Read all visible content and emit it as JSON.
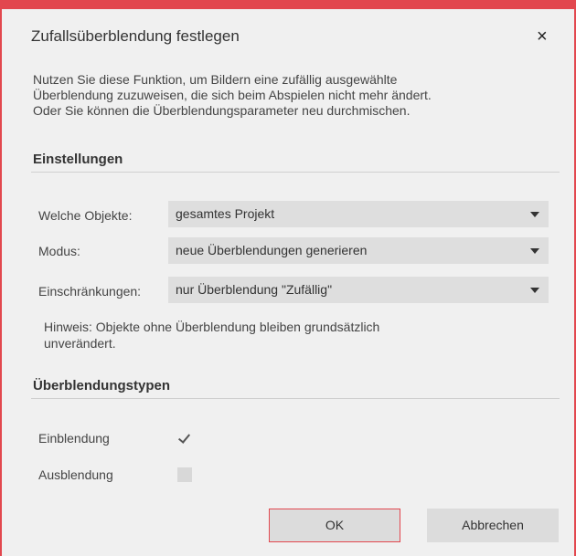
{
  "dialog": {
    "title": "Zufallsüberblendung festlegen",
    "close_glyph": "×",
    "accent_color": "#e2474e"
  },
  "description": {
    "line1": "Nutzen Sie diese Funktion, um Bildern eine zufällig ausgewählte",
    "line2": "Überblendung zuzuweisen, die sich beim Abspielen nicht mehr ändert.",
    "line3": "Oder Sie können die Überblendungsparameter neu durchmischen."
  },
  "settings": {
    "heading": "Einstellungen",
    "objects": {
      "label": "Welche Objekte:",
      "value": "gesamtes Projekt"
    },
    "mode": {
      "label": "Modus:",
      "value": "neue Überblendungen generieren"
    },
    "restrictions": {
      "label": "Einschränkungen:",
      "value": "nur Überblendung \"Zufällig\""
    },
    "hint_line1": "Hinweis: Objekte ohne Überblendung bleiben grundsätzlich",
    "hint_line2": "unverändert."
  },
  "types": {
    "heading": "Überblendungstypen",
    "fade_in": {
      "label": "Einblendung",
      "checked": true
    },
    "fade_out": {
      "label": "Ausblendung",
      "checked": false
    }
  },
  "buttons": {
    "ok": "OK",
    "cancel": "Abbrechen"
  }
}
